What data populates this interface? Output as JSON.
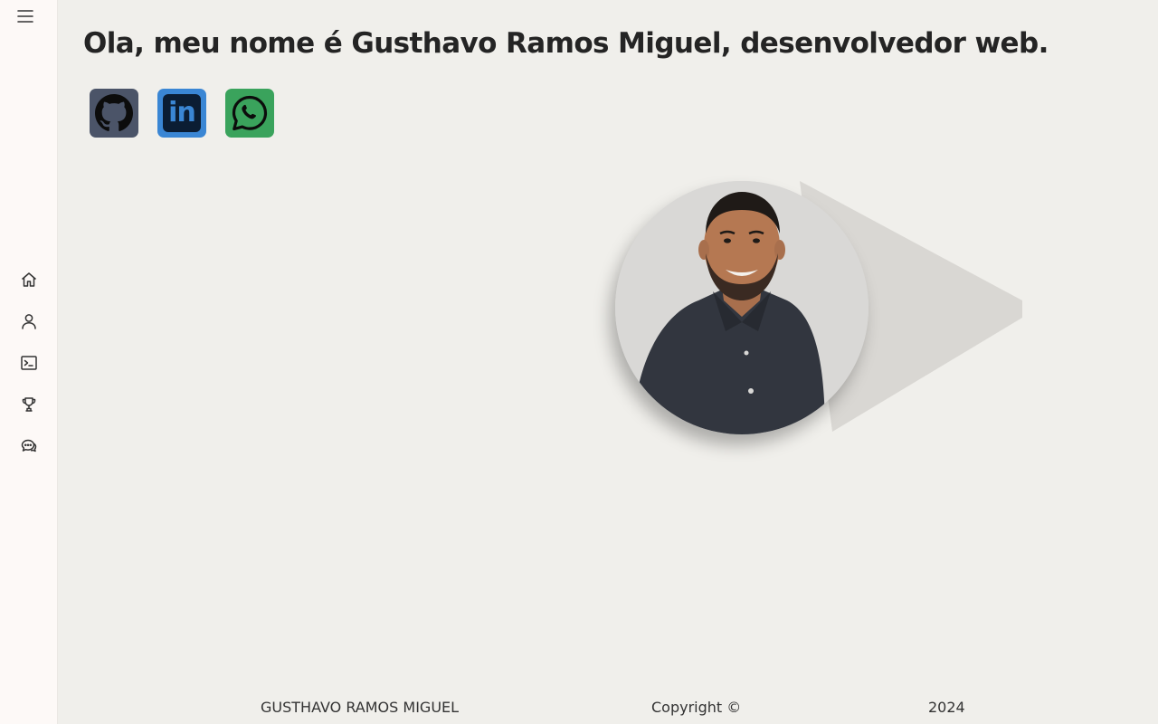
{
  "sidebar": {
    "toggle_icon": "hamburger-icon",
    "items": [
      {
        "id": "home",
        "icon": "home-icon"
      },
      {
        "id": "about",
        "icon": "user-icon"
      },
      {
        "id": "projects",
        "icon": "terminal-icon"
      },
      {
        "id": "achievements",
        "icon": "trophy-icon"
      },
      {
        "id": "contact",
        "icon": "chat-icon"
      }
    ]
  },
  "hero": {
    "headline": "Ola, meu nome é  Gusthavo Ramos Miguel, desenvolvedor web.",
    "photo_icon": "profile-photo"
  },
  "socials": [
    {
      "id": "github",
      "icon": "github-icon",
      "color": "#4b5468"
    },
    {
      "id": "linkedin",
      "icon": "linkedin-icon",
      "color": "#3a86d4",
      "glyph": "in"
    },
    {
      "id": "whatsapp",
      "icon": "whatsapp-icon",
      "color": "#3aa35c"
    }
  ],
  "footer": {
    "name": "GUSTHAVO RAMOS MIGUEL",
    "copyright": "Copyright ©",
    "year": "2024"
  },
  "colors": {
    "background": "#f0efeb",
    "sidebar": "#fdf9f7",
    "text": "#242424"
  }
}
